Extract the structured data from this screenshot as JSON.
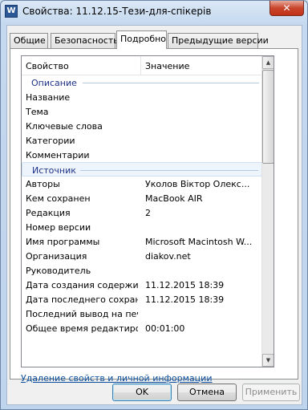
{
  "window": {
    "title": "Свойства: 11.12.15-Тези-для-спікерів",
    "icon_letter": "W",
    "close_label": "✕"
  },
  "tabs": [
    {
      "label": "Общие"
    },
    {
      "label": "Безопасность"
    },
    {
      "label": "Подробно"
    },
    {
      "label": "Предыдущие версии"
    }
  ],
  "list": {
    "col_property": "Свойство",
    "col_value": "Значение",
    "groups": {
      "description": "Описание",
      "source": "Источник"
    },
    "description_rows": [
      {
        "p": "Название",
        "v": ""
      },
      {
        "p": "Тема",
        "v": ""
      },
      {
        "p": "Ключевые слова",
        "v": ""
      },
      {
        "p": "Категории",
        "v": ""
      },
      {
        "p": "Комментарии",
        "v": ""
      }
    ],
    "source_rows": [
      {
        "p": "Авторы",
        "v": "Уколов Віктор Олекс..."
      },
      {
        "p": "Кем сохранен",
        "v": "MacBook AIR"
      },
      {
        "p": "Редакция",
        "v": "2"
      },
      {
        "p": "Номер версии",
        "v": ""
      },
      {
        "p": "Имя программы",
        "v": "Microsoft Macintosh W..."
      },
      {
        "p": "Организация",
        "v": "diakov.net"
      },
      {
        "p": "Руководитель",
        "v": ""
      },
      {
        "p": "Дата создания содержи...",
        "v": "11.12.2015 18:39"
      },
      {
        "p": "Дата последнего сохран...",
        "v": "11.12.2015 18:39"
      },
      {
        "p": "Последний вывод на печ...",
        "v": ""
      },
      {
        "p": "Общее время редактиро...",
        "v": "00:01:00"
      }
    ]
  },
  "remove_link": "Удаление свойств и личной информации",
  "buttons": {
    "ok": "OK",
    "cancel": "Отмена",
    "apply": "Применить"
  },
  "colors": {
    "group_label": "#1e3287",
    "link": "#0c4f9e",
    "close": "#c13218"
  }
}
